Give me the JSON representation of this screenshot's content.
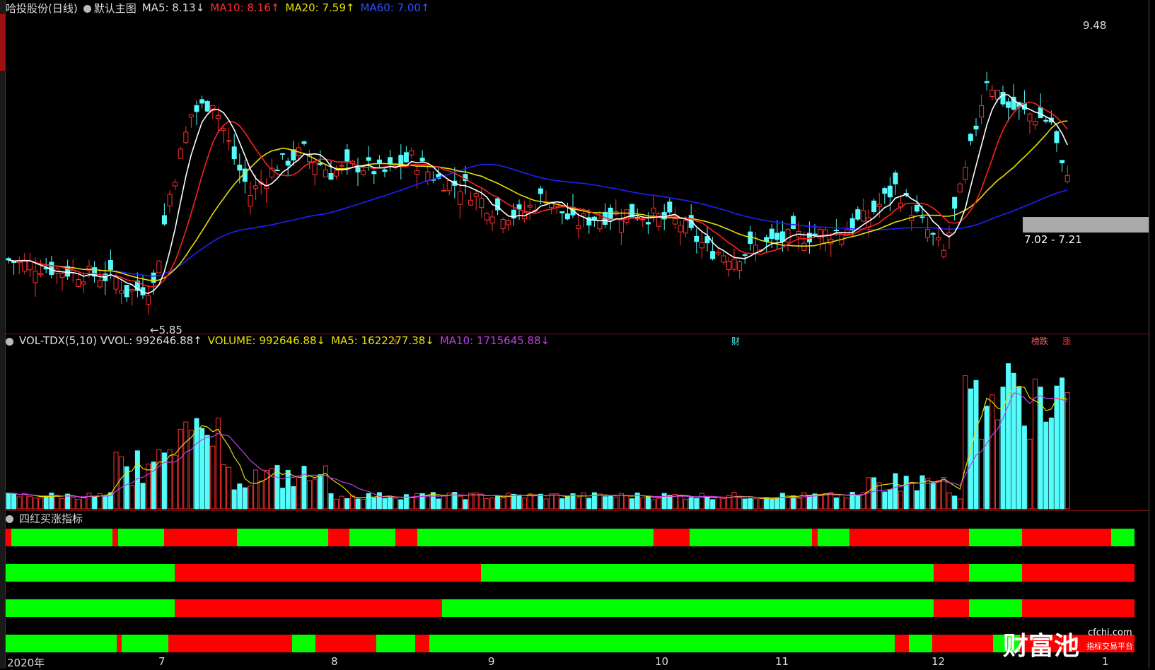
{
  "main_header": {
    "stock": "哈投股份(日线)",
    "template": "默认主图",
    "ma5": "MA5: 8.13↓",
    "ma10": "MA10: 8.16↑",
    "ma20": "MA20: 7.59↑",
    "ma60": "MA60: 7.00↑"
  },
  "annotations": {
    "high": "9.48",
    "low": "←5.85",
    "range_box": "7.02 - 7.21",
    "marker_s": "$",
    "marker_cai": "财",
    "marker_lhb": "榜跌",
    "marker_zhang": "涨"
  },
  "vol_header": {
    "name": "VOL-TDX(5,10) VVOL: 992646.88↑",
    "volume": "VOLUME: 992646.88↓",
    "ma5": "MA5: 1622277.38↓",
    "ma10": "MA10: 1715645.88↓"
  },
  "indicator_header": {
    "name": "四红买涨指标"
  },
  "x_axis": {
    "labels": [
      "2020年",
      "7",
      "8",
      "9",
      "10",
      "11",
      "12",
      "1"
    ]
  },
  "watermark": {
    "brand": "财富池",
    "site": "cfchi.com",
    "slogan": "指标交易平台"
  },
  "colors": {
    "up": "#ff3030",
    "down": "#54fcfc",
    "ma5": "#ffffff",
    "ma10": "#ff2020",
    "ma20": "#e8e000",
    "ma60": "#2020ff",
    "vol_ma5": "#e8e000",
    "vol_ma10": "#c040e0",
    "ind_red": "#ff0000",
    "ind_green": "#00ff00"
  },
  "indicator_rows": [
    [
      [
        "r",
        0.3
      ],
      [
        "g",
        5.7
      ],
      [
        "r",
        0.3
      ],
      [
        "g",
        2.6
      ],
      [
        "r",
        4.1
      ],
      [
        "g",
        5.1
      ],
      [
        "r",
        1.2
      ],
      [
        "g",
        2.6
      ],
      [
        "r",
        1.2
      ],
      [
        "g",
        13.3
      ],
      [
        "r",
        2.0
      ],
      [
        "g",
        6.9
      ],
      [
        "r",
        0.3
      ],
      [
        "g",
        1.8
      ],
      [
        "r",
        6.7
      ],
      [
        "g",
        3.0
      ],
      [
        "r",
        5.0
      ],
      [
        "g",
        1.3
      ]
    ],
    [
      [
        "g",
        9.6
      ],
      [
        "r",
        17.4
      ],
      [
        "g",
        25.7
      ],
      [
        "r",
        2.0
      ],
      [
        "g",
        3.0
      ],
      [
        "r",
        6.4
      ]
    ],
    [
      [
        "g",
        9.6
      ],
      [
        "r",
        15.2
      ],
      [
        "g",
        27.9
      ],
      [
        "r",
        2.0
      ],
      [
        "g",
        3.0
      ],
      [
        "r",
        6.4
      ]
    ],
    [
      [
        "g",
        6.2
      ],
      [
        "r",
        0.3
      ],
      [
        "g",
        2.6
      ],
      [
        "r",
        6.9
      ],
      [
        "g",
        1.3
      ],
      [
        "r",
        3.4
      ],
      [
        "g",
        2.2
      ],
      [
        "r",
        0.8
      ],
      [
        "g",
        26.0
      ],
      [
        "r",
        0.8
      ],
      [
        "g",
        1.3
      ],
      [
        "r",
        3.4
      ],
      [
        "g",
        1.5
      ],
      [
        "r",
        6.4
      ]
    ]
  ]
}
